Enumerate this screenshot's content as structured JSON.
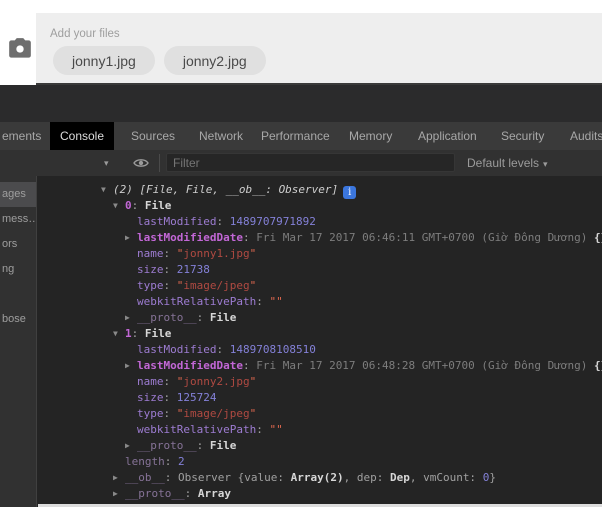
{
  "upload": {
    "label": "Add your files",
    "files": [
      "jonny1.jpg",
      "jonny2.jpg"
    ]
  },
  "devtools": {
    "tabs": [
      {
        "label": "ements",
        "active": false
      },
      {
        "label": "Console",
        "active": true
      },
      {
        "label": "Sources",
        "active": false
      },
      {
        "label": "Network",
        "active": false
      },
      {
        "label": "Performance",
        "active": false
      },
      {
        "label": "Memory",
        "active": false
      },
      {
        "label": "Application",
        "active": false
      },
      {
        "label": "Security",
        "active": false
      },
      {
        "label": "Audits",
        "active": false
      }
    ],
    "toolbar": {
      "context_caret": "▾",
      "filter_placeholder": "Filter",
      "levels_label": "Default levels",
      "levels_caret": "▾"
    },
    "sidebar_fragments": [
      "ages",
      "mess…",
      "ors",
      "ng",
      "",
      "bose"
    ],
    "badge_text": "i",
    "colors": {
      "badge_blue": "#3b76dd",
      "key_purple": "#9d7cd2",
      "key_bold_magenta": "#c267d6",
      "number_blue": "#8481d8",
      "string_red": "#b04a42"
    },
    "console_lines": [
      {
        "ind": 0,
        "ar": "v",
        "badge": true,
        "seg": [
          [
            "(2) [File, File, __ob__: Observer]",
            "i"
          ]
        ]
      },
      {
        "ind": 1,
        "ar": "v",
        "seg": [
          [
            "0",
            "kb"
          ],
          [
            ": ",
            "p"
          ],
          [
            "File",
            "w"
          ]
        ]
      },
      {
        "ind": 2,
        "seg": [
          [
            "lastModified",
            "k"
          ],
          [
            ": ",
            "p"
          ],
          [
            "1489707971892",
            "n"
          ]
        ]
      },
      {
        "ind": 2,
        "ar": "r",
        "seg": [
          [
            "lastModifiedDate",
            "kb"
          ],
          [
            ": ",
            "p"
          ],
          [
            "Fri Mar 17 2017 06:46:11 GMT+0700 (Giờ Đông Dương)",
            "d"
          ],
          [
            " ",
            "p"
          ],
          [
            "{}",
            "w"
          ]
        ]
      },
      {
        "ind": 2,
        "seg": [
          [
            "name",
            "k"
          ],
          [
            ": ",
            "p"
          ],
          [
            "\"",
            "q"
          ],
          [
            "jonny1.jpg",
            "s"
          ],
          [
            "\"",
            "q"
          ]
        ]
      },
      {
        "ind": 2,
        "seg": [
          [
            "size",
            "k"
          ],
          [
            ": ",
            "p"
          ],
          [
            "21738",
            "n"
          ]
        ]
      },
      {
        "ind": 2,
        "seg": [
          [
            "type",
            "k"
          ],
          [
            ": ",
            "p"
          ],
          [
            "\"",
            "q"
          ],
          [
            "image/jpeg",
            "s"
          ],
          [
            "\"",
            "q"
          ]
        ]
      },
      {
        "ind": 2,
        "seg": [
          [
            "webkitRelativePath",
            "k"
          ],
          [
            ": ",
            "p"
          ],
          [
            "\"\"",
            "q"
          ]
        ]
      },
      {
        "ind": 2,
        "ar": "r",
        "seg": [
          [
            "__proto__",
            "kd"
          ],
          [
            ": ",
            "p"
          ],
          [
            "File",
            "w"
          ]
        ]
      },
      {
        "ind": 1,
        "ar": "v",
        "seg": [
          [
            "1",
            "kb"
          ],
          [
            ": ",
            "p"
          ],
          [
            "File",
            "w"
          ]
        ]
      },
      {
        "ind": 2,
        "seg": [
          [
            "lastModified",
            "k"
          ],
          [
            ": ",
            "p"
          ],
          [
            "1489708108510",
            "n"
          ]
        ]
      },
      {
        "ind": 2,
        "ar": "r",
        "seg": [
          [
            "lastModifiedDate",
            "kb"
          ],
          [
            ": ",
            "p"
          ],
          [
            "Fri Mar 17 2017 06:48:28 GMT+0700 (Giờ Đông Dương)",
            "d"
          ],
          [
            " ",
            "p"
          ],
          [
            "{}",
            "w"
          ]
        ]
      },
      {
        "ind": 2,
        "seg": [
          [
            "name",
            "k"
          ],
          [
            ": ",
            "p"
          ],
          [
            "\"",
            "q"
          ],
          [
            "jonny2.jpg",
            "s"
          ],
          [
            "\"",
            "q"
          ]
        ]
      },
      {
        "ind": 2,
        "seg": [
          [
            "size",
            "k"
          ],
          [
            ": ",
            "p"
          ],
          [
            "125724",
            "n"
          ]
        ]
      },
      {
        "ind": 2,
        "seg": [
          [
            "type",
            "k"
          ],
          [
            ": ",
            "p"
          ],
          [
            "\"",
            "q"
          ],
          [
            "image/jpeg",
            "s"
          ],
          [
            "\"",
            "q"
          ]
        ]
      },
      {
        "ind": 2,
        "seg": [
          [
            "webkitRelativePath",
            "k"
          ],
          [
            ": ",
            "p"
          ],
          [
            "\"\"",
            "q"
          ]
        ]
      },
      {
        "ind": 2,
        "ar": "r",
        "seg": [
          [
            "__proto__",
            "kd"
          ],
          [
            ": ",
            "p"
          ],
          [
            "File",
            "w"
          ]
        ]
      },
      {
        "ind": 1,
        "seg": [
          [
            "length",
            "kd"
          ],
          [
            ": ",
            "p"
          ],
          [
            "2",
            "n"
          ]
        ]
      },
      {
        "ind": 1,
        "ar": "r",
        "seg": [
          [
            "__ob__",
            "kd"
          ],
          [
            ": ",
            "p"
          ],
          [
            "Observer ",
            "p"
          ],
          [
            "{",
            "p"
          ],
          [
            "value: ",
            "p"
          ],
          [
            "Array(2)",
            "w"
          ],
          [
            ", ",
            "p"
          ],
          [
            "dep: ",
            "p"
          ],
          [
            "Dep",
            "w"
          ],
          [
            ", ",
            "p"
          ],
          [
            "vmCount: ",
            "p"
          ],
          [
            "0",
            "n"
          ],
          [
            "}",
            "p"
          ]
        ]
      },
      {
        "ind": 1,
        "ar": "r",
        "seg": [
          [
            "__proto__",
            "kd"
          ],
          [
            ": ",
            "p"
          ],
          [
            "Array",
            "w"
          ]
        ]
      }
    ]
  }
}
